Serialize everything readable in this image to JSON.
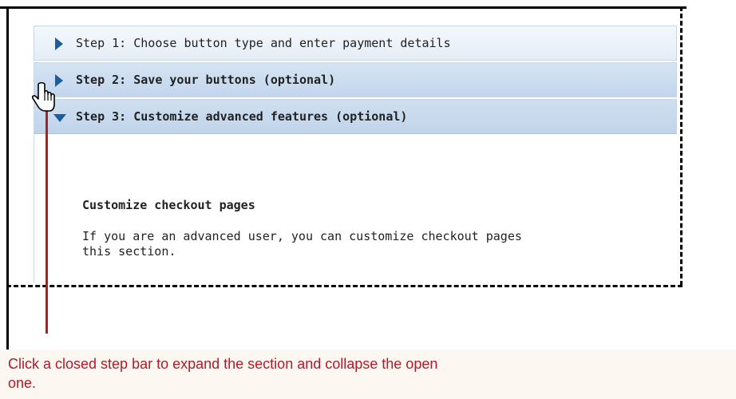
{
  "steps": [
    {
      "label": "Step 1: Choose button type and enter payment details",
      "state": "closed"
    },
    {
      "label": "Step 2: Save your buttons (optional)",
      "state": "closed"
    },
    {
      "label": "Step 3: Customize advanced features (optional)",
      "state": "open"
    }
  ],
  "content": {
    "title": "Customize checkout pages",
    "line1": "If you are an advanced user, you can customize checkout pages",
    "line2": "this section."
  },
  "callout": {
    "text": "Click a closed step bar to expand the section and collapse the open one."
  },
  "colors": {
    "callout_text": "#b01a2a",
    "pointer_line": "#b51c1c",
    "triangle": "#1b5f9a"
  },
  "icons": [
    "triangle-right-icon",
    "triangle-down-icon",
    "hand-cursor-icon"
  ]
}
